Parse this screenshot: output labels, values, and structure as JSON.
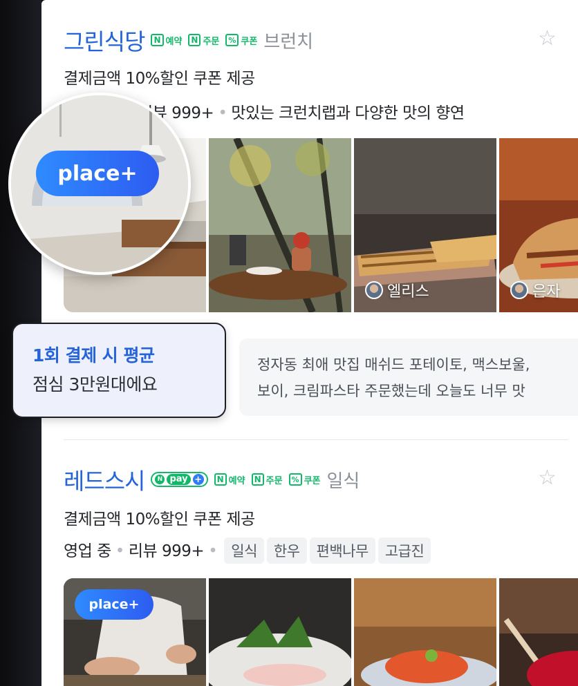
{
  "colors": {
    "brand_blue": "#2563d8",
    "naver_green": "#12b76a",
    "badge_blue": "#2f8bff",
    "tooltip_bg": "#eef1fb"
  },
  "badge_label": "place+",
  "tooltip": {
    "line1": "1회 결제 시 평균",
    "line2": "점심 3만원대에요"
  },
  "listings": [
    {
      "name": "그린식당",
      "has_npay": false,
      "features": [
        {
          "icon": "naver-n-icon",
          "glyph": "N",
          "label": "예약"
        },
        {
          "icon": "naver-n-icon",
          "glyph": "N",
          "label": "주문"
        },
        {
          "icon": "coupon-percent-icon",
          "glyph": "%",
          "label": "쿠폰"
        }
      ],
      "category": "브런치",
      "star_icon": "star-outline-icon",
      "coupon_text": "결제금액 10%할인 쿠폰 제공",
      "meta": {
        "review": "리뷰 999+",
        "description": "맛있는 크런치랩과 다양한 맛의 향연"
      },
      "reviewers": [
        "엘리스",
        "은자"
      ],
      "review_snippet": {
        "line1": "정자동 최애 맛집 매쉬드 포테이토, 맥스보울,",
        "line2": "보이, 크림파스타 주문했는데 오늘도 너무 맛"
      }
    },
    {
      "name": "레드스시",
      "has_npay": true,
      "npay_label": "pay",
      "features": [
        {
          "icon": "naver-n-icon",
          "glyph": "N",
          "label": "예약"
        },
        {
          "icon": "naver-n-icon",
          "glyph": "N",
          "label": "주문"
        },
        {
          "icon": "coupon-percent-icon",
          "glyph": "%",
          "label": "쿠폰"
        }
      ],
      "category": "일식",
      "star_icon": "star-outline-icon",
      "coupon_text": "결제금액 10%할인 쿠폰 제공",
      "meta": {
        "status": "영업 중",
        "review": "리뷰 999+"
      },
      "tags": [
        "일식",
        "한우",
        "편백나무",
        "고급진"
      ]
    }
  ]
}
